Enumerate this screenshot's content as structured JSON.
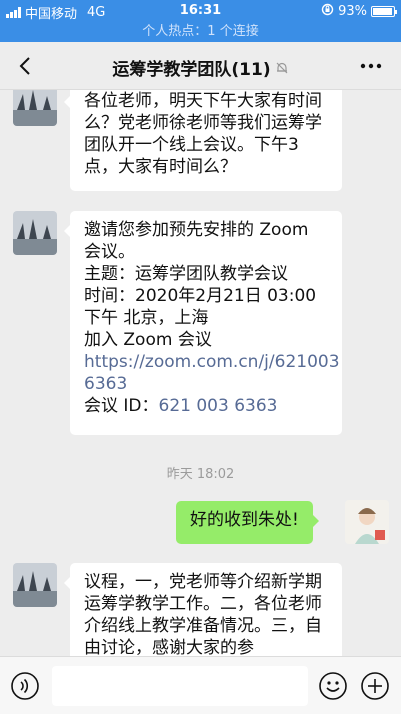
{
  "status": {
    "carrier": "中国移动",
    "network": "4G",
    "time": "16:31",
    "battery": "93%",
    "battery_level": 0.93
  },
  "hotspot": "个人热点：1 个连接",
  "nav": {
    "title": "运筹学教学团队(11)"
  },
  "messages": [
    {
      "text": "各位老师，明天下午大家有时间么？党老师徐老师等我们运筹学团队开一个线上会议。下午3点，大家有时间么？"
    },
    {
      "l1": "邀请您参加预先安排的 Zoom",
      "l2": "会议。",
      "l3": "主题：运筹学团队教学会议",
      "l4": "时间：2020年2月21日 03:00",
      "l5": "下午 北京，上海",
      "l6": "加入 Zoom 会议",
      "link1": "https://zoom.com.cn/j/621003",
      "link2": "6363",
      "id_label": "会议 ID：",
      "id_value": "621 003 6363"
    },
    {
      "text": "好的收到朱处!"
    },
    {
      "text": "议程，一，党老师等介绍新学期运筹学教学工作。二，各位老师介绍线上教学准备情况。三，自由讨论，感谢大家的参"
    }
  ],
  "timestamp": "昨天 18:02",
  "colors": {
    "status_bar": "#3a8ee6",
    "sent_bubble": "#95ec69",
    "link": "#576b95"
  }
}
